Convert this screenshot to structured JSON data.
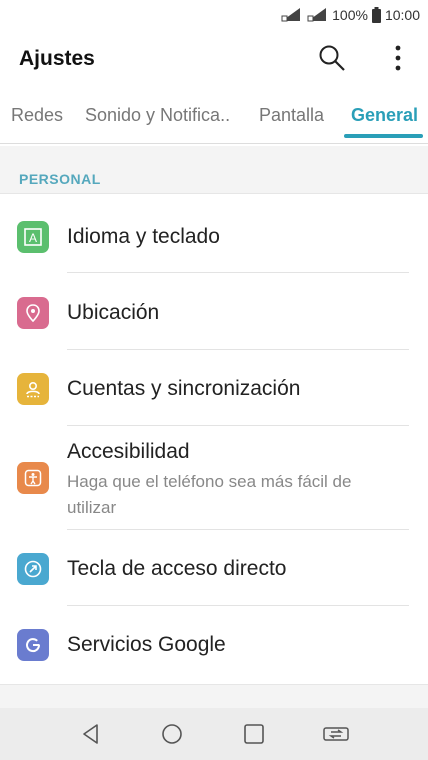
{
  "status": {
    "battery": "100%",
    "time": "10:00"
  },
  "app": {
    "title": "Ajustes"
  },
  "tabs": [
    {
      "label": "Redes"
    },
    {
      "label": "Sonido y Notifica.."
    },
    {
      "label": "Pantalla"
    },
    {
      "label": "General"
    }
  ],
  "section": {
    "title": "PERSONAL"
  },
  "items": [
    {
      "label": "Idioma y teclado",
      "icon": "language-icon",
      "color": "#5bbf6e"
    },
    {
      "label": "Ubicación",
      "icon": "location-icon",
      "color": "#d96b8f"
    },
    {
      "label": "Cuentas y sincronización",
      "icon": "accounts-icon",
      "color": "#e6b43b"
    },
    {
      "label": "Accesibilidad",
      "sublabel": "Haga que el teléfono sea más fácil de utilizar",
      "icon": "accessibility-icon",
      "color": "#e8894b"
    },
    {
      "label": "Tecla de acceso directo",
      "icon": "shortcut-key-icon",
      "color": "#4aa8d0"
    },
    {
      "label": "Servicios Google",
      "icon": "google-icon",
      "color": "#6a7ccf"
    }
  ],
  "colors": {
    "accent": "#2a9fb8",
    "section_header": "#55a8bd"
  }
}
